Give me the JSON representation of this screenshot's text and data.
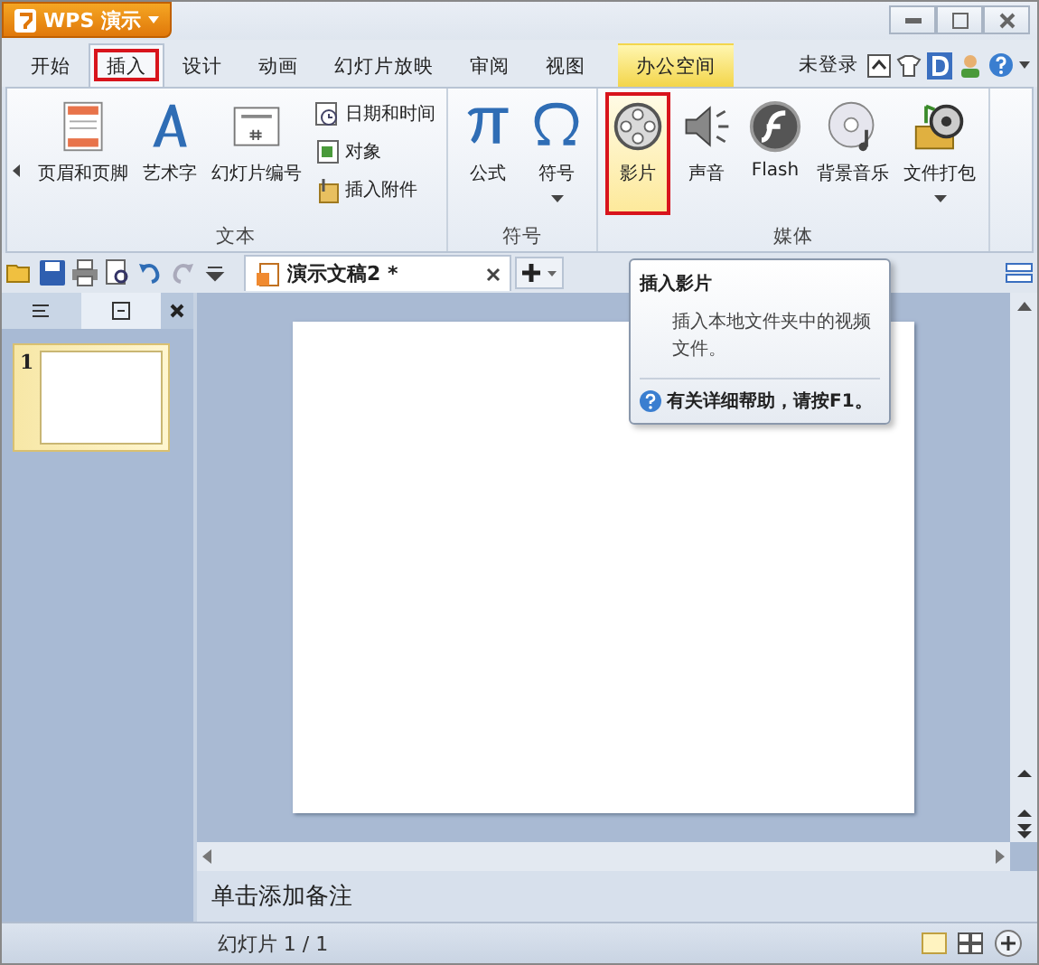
{
  "app_menu": {
    "label": "WPS 演示"
  },
  "tabs": [
    {
      "label": "开始",
      "selected": false,
      "kind": "plain"
    },
    {
      "label": "插入",
      "selected": true,
      "kind": "plain"
    },
    {
      "label": "设计",
      "selected": false,
      "kind": "plain"
    },
    {
      "label": "动画",
      "selected": false,
      "kind": "plain"
    },
    {
      "label": "幻灯片放映",
      "selected": false,
      "kind": "plain"
    },
    {
      "label": "审阅",
      "selected": false,
      "kind": "plain"
    },
    {
      "label": "视图",
      "selected": false,
      "kind": "plain"
    },
    {
      "label": "办公空间",
      "selected": false,
      "kind": "highlight"
    }
  ],
  "account": {
    "label": "未登录"
  },
  "ribbon": {
    "groups": [
      {
        "title": "文本",
        "items": [
          {
            "label": "页眉和页脚",
            "kind": "large",
            "hovered": false,
            "dropdown": false
          },
          {
            "label": "艺术字",
            "kind": "large",
            "hovered": false,
            "dropdown": false
          },
          {
            "label": "幻灯片编号",
            "kind": "large",
            "hovered": false,
            "dropdown": false
          },
          {
            "label": "日期和时间",
            "kind": "small"
          },
          {
            "label": "对象",
            "kind": "small"
          },
          {
            "label": "插入附件",
            "kind": "small"
          }
        ]
      },
      {
        "title": "符号",
        "items": [
          {
            "label": "公式",
            "kind": "large",
            "hovered": false,
            "dropdown": false
          },
          {
            "label": "符号",
            "kind": "large",
            "hovered": false,
            "dropdown": true
          }
        ]
      },
      {
        "title": "媒体",
        "items": [
          {
            "label": "影片",
            "kind": "large",
            "hovered": true,
            "dropdown": false
          },
          {
            "label": "声音",
            "kind": "large",
            "hovered": false,
            "dropdown": false
          },
          {
            "label": "Flash",
            "kind": "large",
            "hovered": false,
            "dropdown": false
          },
          {
            "label": "背景音乐",
            "kind": "large",
            "hovered": false,
            "dropdown": false
          },
          {
            "label": "文件打包",
            "kind": "large",
            "hovered": false,
            "dropdown": true
          }
        ]
      }
    ]
  },
  "document_tab": {
    "title": "演示文稿2 *"
  },
  "tooltip": {
    "title": "插入影片",
    "body": "插入本地文件夹中的视频文件。",
    "help": "有关详细帮助，请按F1。"
  },
  "panel_tabs": [
    {
      "kind": "outline",
      "selected": false
    },
    {
      "kind": "slides",
      "selected": true
    }
  ],
  "slides": [
    {
      "number": "1",
      "selected": true
    }
  ],
  "notes": {
    "placeholder": "单击添加备注"
  },
  "status_bar": {
    "slide_counter": "幻灯片 1 / 1"
  }
}
